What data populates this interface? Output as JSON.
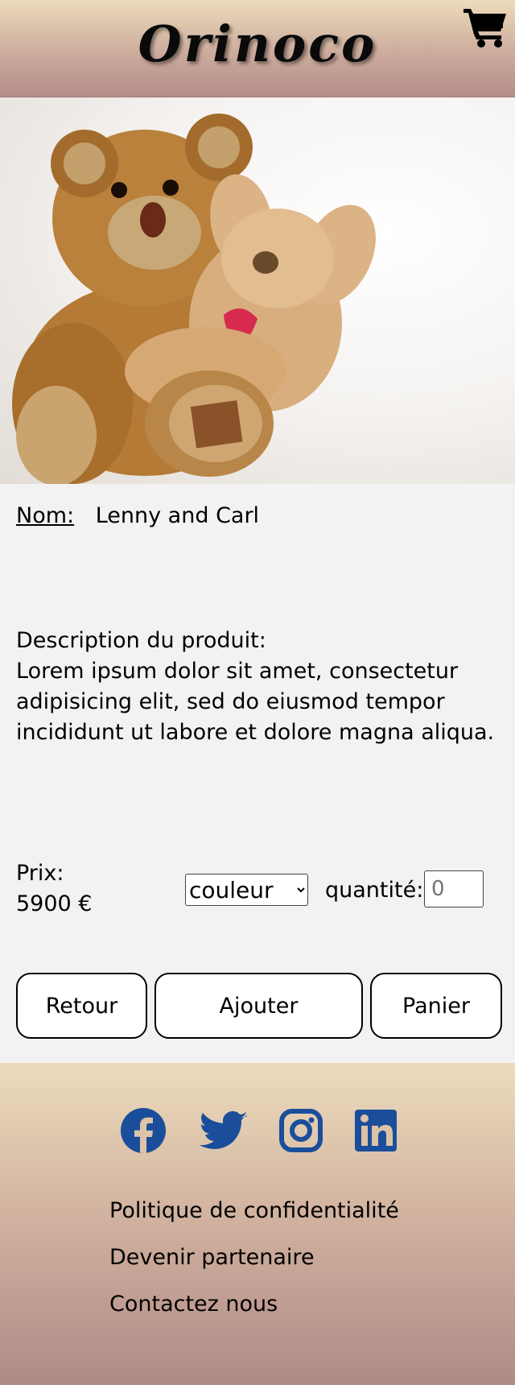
{
  "header": {
    "brand": "Orinoco",
    "cart_icon": "shopping-cart-icon"
  },
  "product": {
    "image_alt": "Lenny and Carl teddy bears",
    "name_label": "Nom:",
    "name": "Lenny and Carl",
    "description_label": "Description du produit:",
    "description": "Lorem ipsum dolor sit amet, consectetur adipisicing elit, sed do eiusmod tempor incididunt ut labore et dolore magna aliqua.",
    "price_label": "Prix:",
    "price": "5900 €",
    "color_select_value": "couleur",
    "quantity_label": "quantité:",
    "quantity_placeholder": "0"
  },
  "actions": {
    "back": "Retour",
    "add": "Ajouter",
    "cart": "Panier"
  },
  "footer": {
    "social_icons": [
      "facebook-icon",
      "twitter-icon",
      "instagram-icon",
      "linkedin-icon"
    ],
    "social_color": "#1a4e9b",
    "links": [
      "Politique de confidentialité",
      "Devenir partenaire",
      "Contactez nous"
    ]
  }
}
